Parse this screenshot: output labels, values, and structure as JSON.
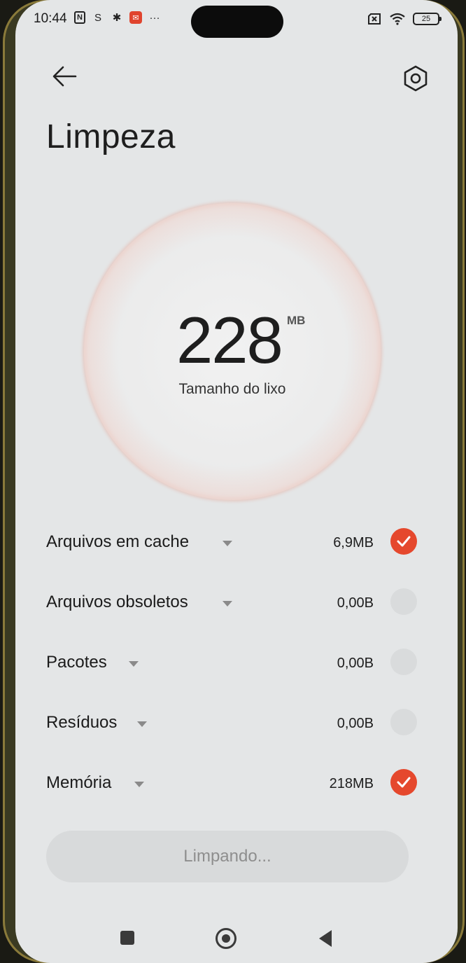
{
  "status_bar": {
    "time": "10:44",
    "battery": "25",
    "icons": [
      "nfc-icon",
      "s-icon",
      "gear-icon",
      "app-notification-icon",
      "more-dots-icon",
      "sim-off-icon",
      "wifi-icon",
      "battery-icon"
    ]
  },
  "header": {
    "title": "Limpeza"
  },
  "summary": {
    "value": "228",
    "unit": "MB",
    "label": "Tamanho do lixo",
    "accent_color": "#e5482d"
  },
  "categories": [
    {
      "label": "Arquivos em cache",
      "size": "6,9MB",
      "checked": true
    },
    {
      "label": "Arquivos obsoletos",
      "size": "0,00B",
      "checked": false
    },
    {
      "label": "Pacotes",
      "size": "0,00B",
      "checked": false
    },
    {
      "label": "Resíduos",
      "size": "0,00B",
      "checked": false
    },
    {
      "label": "Memória",
      "size": "218MB",
      "checked": true
    }
  ],
  "action": {
    "label": "Limpando..."
  }
}
